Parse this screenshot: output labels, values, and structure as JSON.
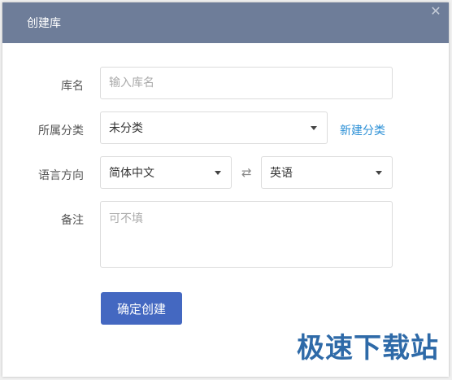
{
  "dialog": {
    "title": "创建库",
    "close_icon": "close-icon"
  },
  "form": {
    "name_label": "库名",
    "name_placeholder": "输入库名",
    "category_label": "所属分类",
    "category_value": "未分类",
    "new_category_link": "新建分类",
    "language_label": "语言方向",
    "source_language": "简体中文",
    "swap_icon": "swap-icon",
    "target_language": "英语",
    "note_label": "备注",
    "note_placeholder": "可不填",
    "submit_label": "确定创建"
  },
  "watermark": {
    "text": "极速下载站"
  },
  "colors": {
    "titlebar": "#6e7d99",
    "primary_button": "#4468c1",
    "link": "#2a8fd6"
  }
}
